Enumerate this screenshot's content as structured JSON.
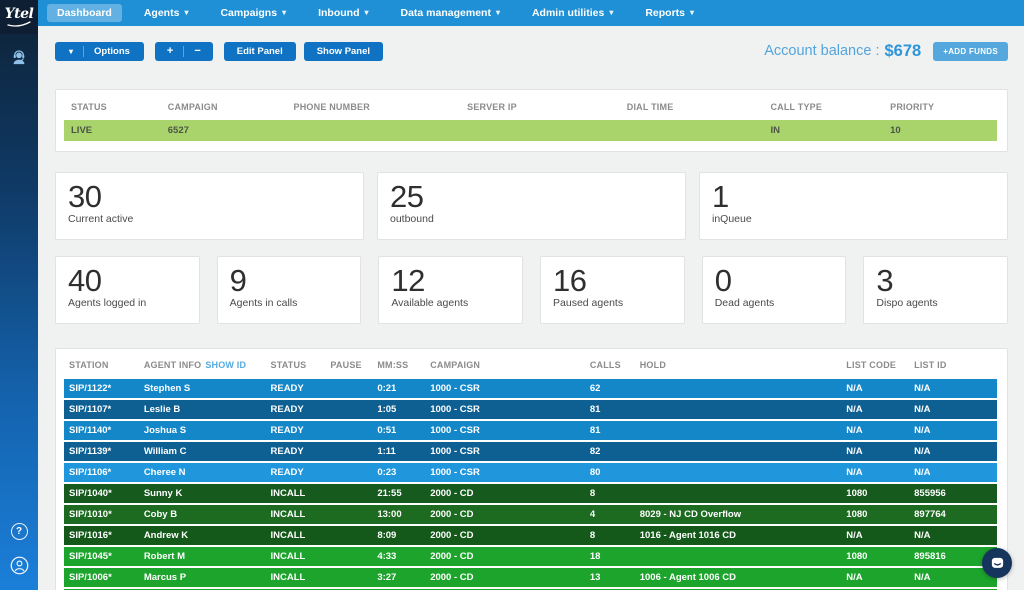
{
  "brand": {
    "logo": "Ytel"
  },
  "nav": {
    "items": [
      {
        "label": "Dashboard",
        "active": true,
        "caret": false
      },
      {
        "label": "Agents",
        "active": false,
        "caret": true
      },
      {
        "label": "Campaigns",
        "active": false,
        "caret": true
      },
      {
        "label": "Inbound",
        "active": false,
        "caret": true
      },
      {
        "label": "Data management",
        "active": false,
        "caret": true
      },
      {
        "label": "Admin utilities",
        "active": false,
        "caret": true
      },
      {
        "label": "Reports",
        "active": false,
        "caret": true
      }
    ]
  },
  "toolbar": {
    "options_label": "Options",
    "plus": "+",
    "minus": "−",
    "edit_panel": "Edit Panel",
    "show_panel": "Show Panel"
  },
  "account": {
    "label": "Account balance :",
    "amount": "$678",
    "add_funds": "+ADD FUNDS"
  },
  "campaign_table": {
    "columns": [
      "STATUS",
      "CAMPAIGN",
      "PHONE NUMBER",
      "SERVER IP",
      "DIAL TIME",
      "CALL TYPE",
      "PRIORITY"
    ],
    "row": {
      "status": "LIVE",
      "campaign": "6527",
      "phone_number": "",
      "server_ip": "",
      "dial_time": "",
      "call_type": "IN",
      "priority": "10"
    }
  },
  "stats_row1": [
    {
      "value": "30",
      "label": "Current active"
    },
    {
      "value": "25",
      "label": "outbound"
    },
    {
      "value": "1",
      "label": "inQueue"
    }
  ],
  "stats_row2": [
    {
      "value": "40",
      "label": "Agents logged in"
    },
    {
      "value": "9",
      "label": "Agents in calls"
    },
    {
      "value": "12",
      "label": "Available agents"
    },
    {
      "value": "16",
      "label": "Paused agents"
    },
    {
      "value": "0",
      "label": "Dead agents"
    },
    {
      "value": "3",
      "label": "Dispo agents"
    }
  ],
  "agent_table": {
    "columns": [
      "STATION",
      "AGENT INFO",
      "STATUS",
      "PAUSE",
      "MM:SS",
      "CAMPAIGN",
      "CALLS",
      "HOLD",
      "LIST CODE",
      "LIST ID"
    ],
    "show_id_link": "SHOW ID",
    "rows": [
      {
        "station": "SIP/1122*",
        "agent": "Stephen S",
        "status": "READY",
        "pause": "",
        "mmss": "0:21",
        "campaign": "1000 - CSR",
        "calls": "62",
        "hold": "",
        "list_code": "N/A",
        "list_id": "N/A",
        "shade": "blue_light"
      },
      {
        "station": "SIP/1107*",
        "agent": "Leslie B",
        "status": "READY",
        "pause": "",
        "mmss": "1:05",
        "campaign": "1000 - CSR",
        "calls": "81",
        "hold": "",
        "list_code": "N/A",
        "list_id": "N/A",
        "shade": "blue_dark"
      },
      {
        "station": "SIP/1140*",
        "agent": "Joshua S",
        "status": "READY",
        "pause": "",
        "mmss": "0:51",
        "campaign": "1000 - CSR",
        "calls": "81",
        "hold": "",
        "list_code": "N/A",
        "list_id": "N/A",
        "shade": "blue_light"
      },
      {
        "station": "SIP/1139*",
        "agent": "William C",
        "status": "READY",
        "pause": "",
        "mmss": "1:11",
        "campaign": "1000 - CSR",
        "calls": "82",
        "hold": "",
        "list_code": "N/A",
        "list_id": "N/A",
        "shade": "blue_dark"
      },
      {
        "station": "SIP/1106*",
        "agent": "Cheree N",
        "status": "READY",
        "pause": "",
        "mmss": "0:23",
        "campaign": "1000 - CSR",
        "calls": "80",
        "hold": "",
        "list_code": "N/A",
        "list_id": "N/A",
        "shade": "blue_bright"
      },
      {
        "station": "SIP/1040*",
        "agent": "Sunny K",
        "status": "INCALL",
        "pause": "",
        "mmss": "21:55",
        "campaign": "2000 - CD",
        "calls": "8",
        "hold": "",
        "list_code": "1080",
        "list_id": "855956",
        "shade": "green_dark"
      },
      {
        "station": "SIP/1010*",
        "agent": "Coby B",
        "status": "INCALL",
        "pause": "",
        "mmss": "13:00",
        "campaign": "2000 - CD",
        "calls": "4",
        "hold": "8029 - NJ CD Overflow",
        "list_code": "1080",
        "list_id": "897764",
        "shade": "green_mid"
      },
      {
        "station": "SIP/1016*",
        "agent": "Andrew K",
        "status": "INCALL",
        "pause": "",
        "mmss": "8:09",
        "campaign": "2000 - CD",
        "calls": "8",
        "hold": "1016 - Agent 1016 CD",
        "list_code": "N/A",
        "list_id": "N/A",
        "shade": "green_dark2"
      },
      {
        "station": "SIP/1045*",
        "agent": "Robert M",
        "status": "INCALL",
        "pause": "",
        "mmss": "4:33",
        "campaign": "2000 - CD",
        "calls": "18",
        "hold": "",
        "list_code": "1080",
        "list_id": "895816",
        "shade": "green_bright"
      },
      {
        "station": "SIP/1006*",
        "agent": "Marcus P",
        "status": "INCALL",
        "pause": "",
        "mmss": "3:27",
        "campaign": "2000 - CD",
        "calls": "13",
        "hold": "1006 - Agent 1006 CD",
        "list_code": "N/A",
        "list_id": "N/A",
        "shade": "green_bright"
      }
    ],
    "partial_row_shade": "green_bright"
  },
  "icons": {
    "help_glyph": "?"
  },
  "colors": {
    "nav_blue": "#1f90d6",
    "button_blue": "#0f72c2",
    "add_funds_blue": "#55a8de",
    "balance_blue": "#2e96d8",
    "live_row_green": "#a9d46c",
    "shades": {
      "blue_light": "#1487c8",
      "blue_dark": "#0e6093",
      "blue_bright": "#2097dc",
      "green_dark": "#165a1e",
      "green_mid": "#1c6b20",
      "green_dark2": "#14591a",
      "green_bright": "#1da42c"
    }
  }
}
